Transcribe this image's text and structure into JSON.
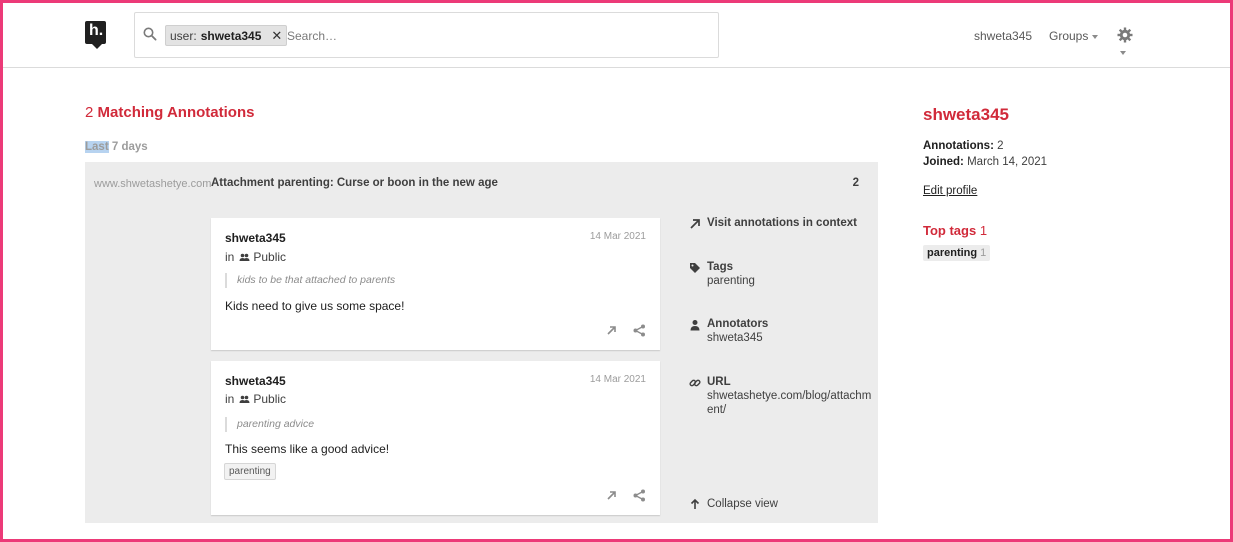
{
  "nav": {
    "search": {
      "filter_prefix": "user:",
      "filter_value": "shweta345",
      "remove_glyph": "✕",
      "placeholder": "Search…"
    },
    "username": "shweta345",
    "groups_label": "Groups"
  },
  "results": {
    "count": "2",
    "title": "Matching Annotations",
    "time_header_hl": "Last",
    "time_header_rest": " 7 days"
  },
  "bucket": {
    "domain": "www.shwetashetye.com",
    "title": "Attachment parenting: Curse or boon in the new age",
    "count": "2",
    "annotations": [
      {
        "user": "shweta345",
        "date": "14 Mar 2021",
        "group_prefix": "in",
        "group": "Public",
        "quote": "kids to be that attached to parents",
        "text": "Kids need to give us some space!",
        "tags": []
      },
      {
        "user": "shweta345",
        "date": "14 Mar 2021",
        "group_prefix": "in",
        "group": "Public",
        "quote": "parenting advice",
        "text": "This seems like a good advice!",
        "tags": [
          "parenting"
        ]
      }
    ],
    "side": {
      "visit_label": "Visit annotations in context",
      "tags_label": "Tags",
      "tags_value": "parenting",
      "annotators_label": "Annotators",
      "annotators_value": "shweta345",
      "url_label": "URL",
      "url_value": "shwetashetye.com/blog/attachment/",
      "collapse_label": "Collapse view"
    }
  },
  "profile": {
    "name": "shweta345",
    "annotations_label": "Annotations:",
    "annotations_value": "2",
    "joined_label": "Joined:",
    "joined_value": "March 14, 2021",
    "edit_label": "Edit profile",
    "top_tags_label": "Top tags",
    "top_tags_count": "1",
    "tags": [
      {
        "name": "parenting",
        "count": "1"
      }
    ]
  },
  "colors": {
    "brand_red": "#d12a3a",
    "frame": "#ec3a78",
    "bucket_bg": "#ececec"
  },
  "icons": [
    "hypothesis-logo",
    "search-icon",
    "gear-icon",
    "groups-icon",
    "share-icon",
    "external-link-icon",
    "tag-icon",
    "user-icon",
    "link-icon",
    "arrow-up-icon"
  ]
}
